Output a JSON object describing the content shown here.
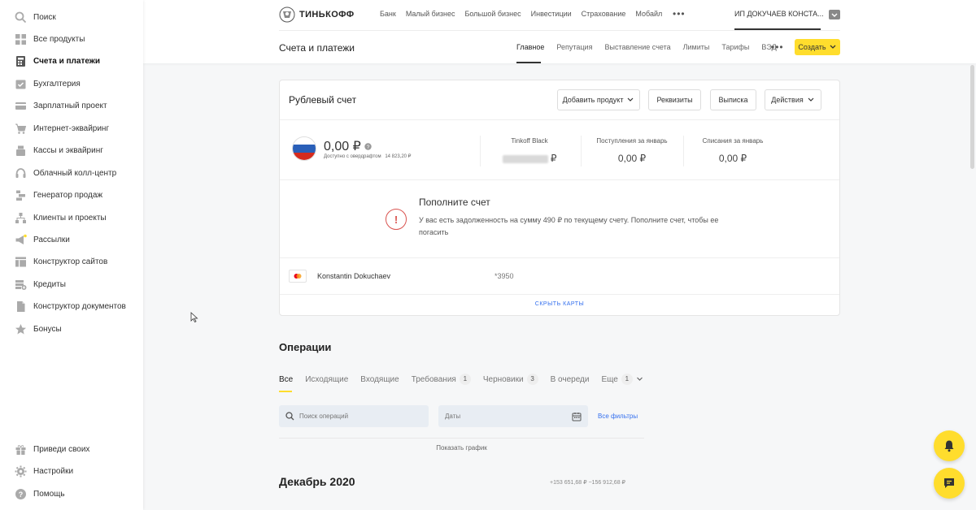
{
  "sidebar": {
    "items": [
      {
        "label": "Поиск",
        "icon": "search-icon"
      },
      {
        "label": "Все продукты",
        "icon": "grid-icon"
      },
      {
        "label": "Счета и платежи",
        "icon": "calculator-icon",
        "active": true
      },
      {
        "label": "Бухгалтерия",
        "icon": "calendar-check-icon"
      },
      {
        "label": "Зарплатный проект",
        "icon": "card-icon"
      },
      {
        "label": "Интернет-эквайринг",
        "icon": "cart-icon"
      },
      {
        "label": "Кассы и эквайринг",
        "icon": "register-icon"
      },
      {
        "label": "Облачный колл-центр",
        "icon": "headset-icon"
      },
      {
        "label": "Генератор продаж",
        "icon": "sales-funnel-icon"
      },
      {
        "label": "Клиенты и проекты",
        "icon": "hierarchy-icon"
      },
      {
        "label": "Рассылки",
        "icon": "megaphone-icon"
      },
      {
        "label": "Конструктор сайтов",
        "icon": "layout-icon"
      },
      {
        "label": "Кредиты",
        "icon": "credit-stack-icon"
      },
      {
        "label": "Конструктор документов",
        "icon": "document-icon"
      },
      {
        "label": "Бонусы",
        "icon": "star-icon"
      }
    ],
    "bottom_items": [
      {
        "label": "Приведи своих",
        "icon": "gift-icon"
      },
      {
        "label": "Настройки",
        "icon": "gear-icon"
      },
      {
        "label": "Помощь",
        "icon": "help-icon"
      }
    ]
  },
  "header": {
    "brand": "ТИНЬКОФФ",
    "nav": [
      "Банк",
      "Малый бизнес",
      "Большой бизнес",
      "Инвестиции",
      "Страхование",
      "Мобайл"
    ],
    "more": "•••",
    "user": "ИП ДОКУЧАЕВ КОНСТА..."
  },
  "subheader": {
    "title": "Счета и платежи",
    "tabs": [
      "Главное",
      "Репутация",
      "Выставление счета",
      "Лимиты",
      "Тарифы",
      "ВЭД"
    ],
    "more": "•••",
    "create_label": "Создать"
  },
  "account": {
    "title": "Рублевый счет",
    "buttons": {
      "add_product": "Добавить продукт",
      "requisites": "Реквизиты",
      "statement": "Выписка",
      "actions": "Действия"
    },
    "balance": "0,00 ₽",
    "overdraft_label": "Доступно с овердрафтом",
    "overdraft_value": "14 823,20 ₽",
    "stats": [
      {
        "label": "Tinkoff Black",
        "value": "₽"
      },
      {
        "label": "Поступления за январь",
        "value": "0,00 ₽"
      },
      {
        "label": "Списания за январь",
        "value": "0,00 ₽"
      }
    ],
    "warning": {
      "title": "Пополните счет",
      "text": "У вас есть задолженность на сумму 490 ₽ по текущему счету. Пополните счет, чтобы ее погасить"
    },
    "card": {
      "owner": "Konstantin Dokuchaev",
      "number": "*3950"
    },
    "hide_cards": "СКРЫТЬ КАРТЫ"
  },
  "operations": {
    "title": "Операции",
    "tabs": [
      {
        "label": "Все",
        "badge": ""
      },
      {
        "label": "Исходящие",
        "badge": ""
      },
      {
        "label": "Входящие",
        "badge": ""
      },
      {
        "label": "Требования",
        "badge": "1"
      },
      {
        "label": "Черновики",
        "badge": "3"
      },
      {
        "label": "В очереди",
        "badge": ""
      },
      {
        "label": "Еще",
        "badge": "1"
      }
    ],
    "search_placeholder": "Поиск операций",
    "dates_placeholder": "Даты",
    "all_filters": "Все фильтры",
    "show_graph": "Показать график",
    "month": "Декабрь 2020",
    "month_sum": "+153 651,68 ₽  −156 912,68 ₽"
  },
  "colors": {
    "accent": "#ffdd2d",
    "link": "#336fee",
    "warning": "#d9534f"
  }
}
